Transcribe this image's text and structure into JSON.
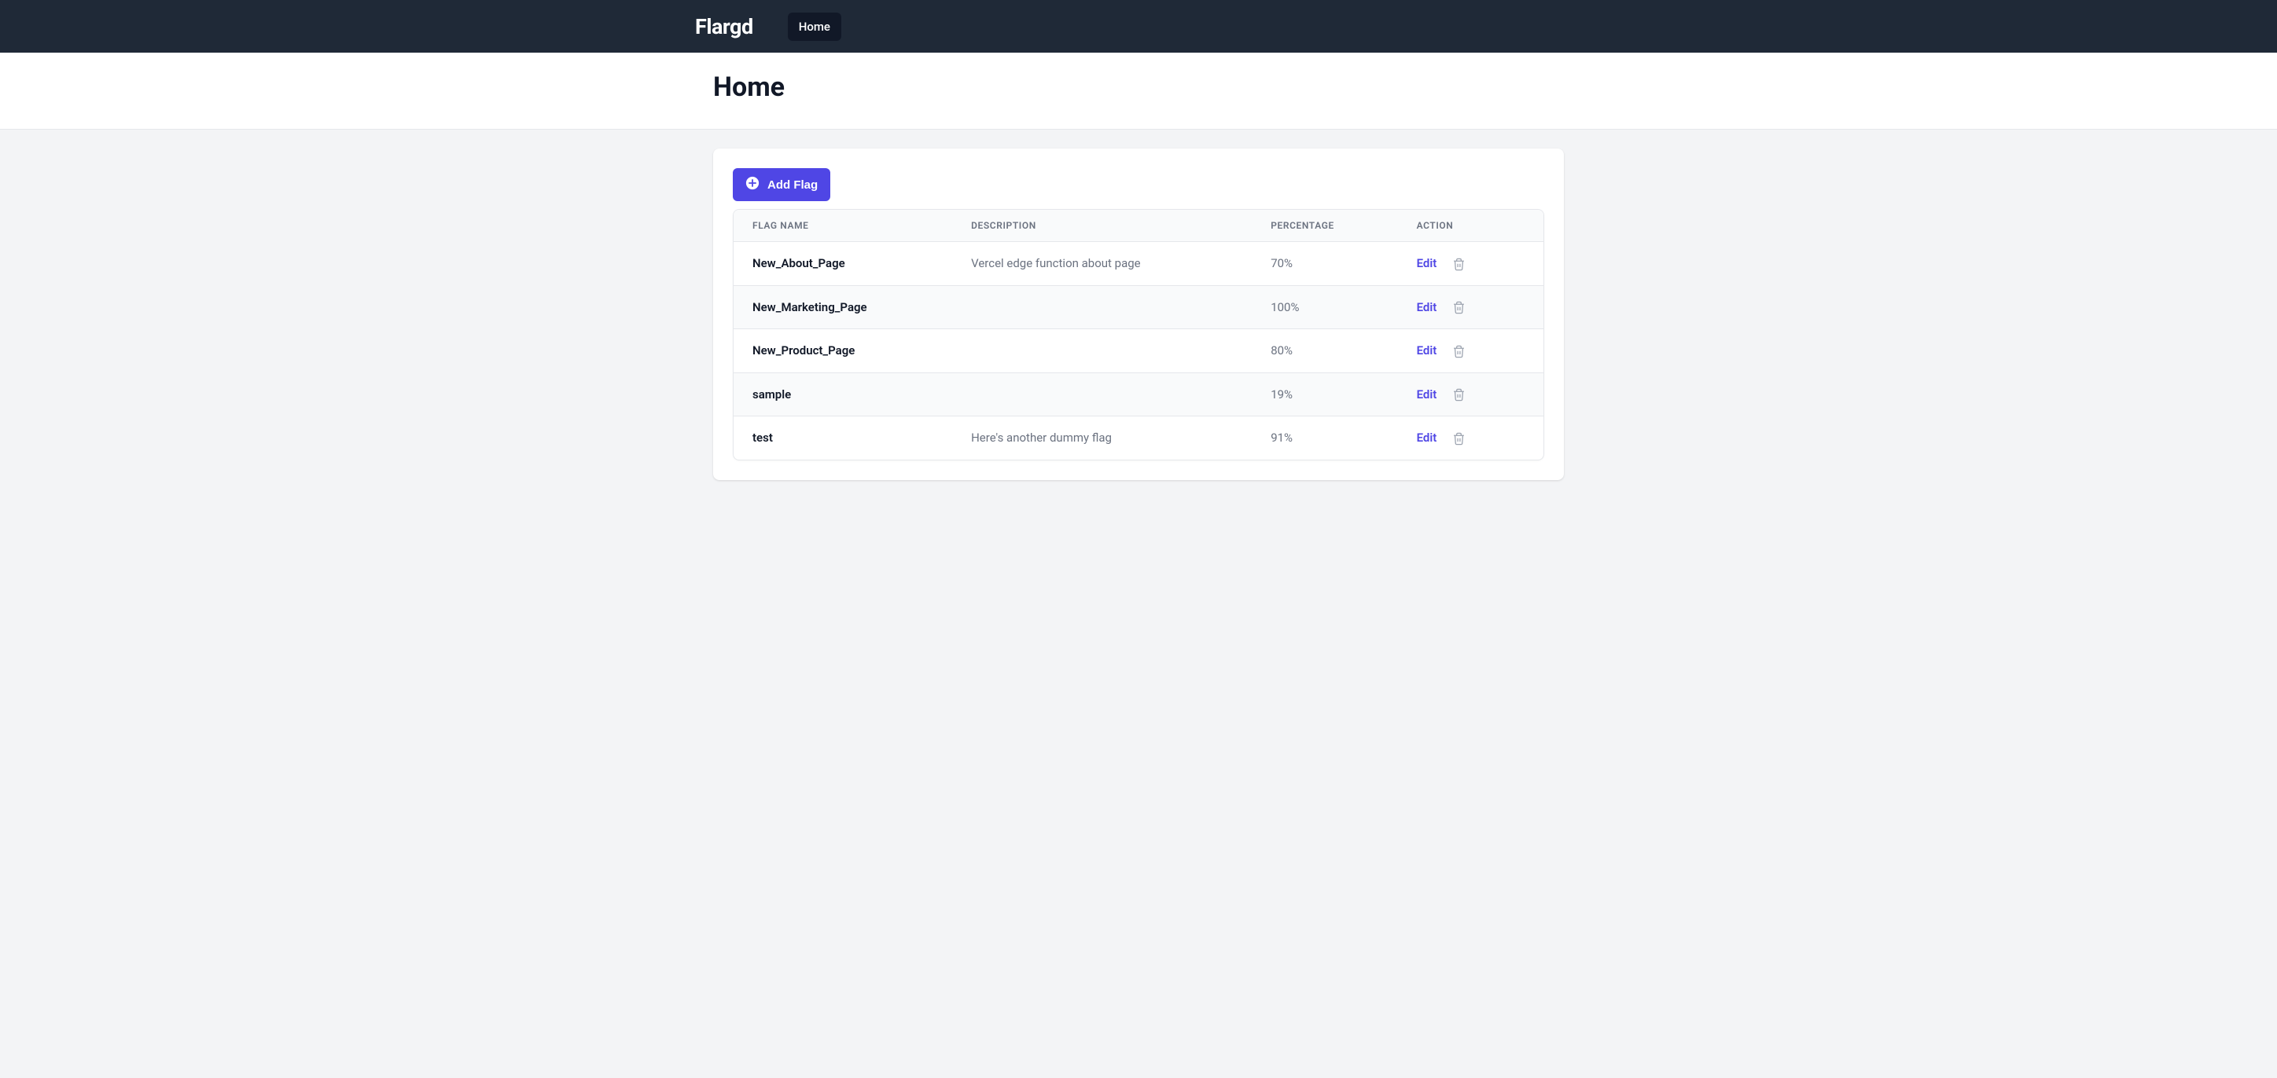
{
  "nav": {
    "brand": "Flargd",
    "home_label": "Home"
  },
  "header": {
    "title": "Home"
  },
  "actions": {
    "add_flag_label": "Add Flag",
    "edit_label": "Edit"
  },
  "table": {
    "columns": {
      "flag_name": "Flag Name",
      "description": "Description",
      "percentage": "Percentage",
      "action": "Action"
    },
    "rows": [
      {
        "flag_name": "New_About_Page",
        "description": "Vercel edge function about page",
        "percentage": "70%"
      },
      {
        "flag_name": "New_Marketing_Page",
        "description": "",
        "percentage": "100%"
      },
      {
        "flag_name": "New_Product_Page",
        "description": "",
        "percentage": "80%"
      },
      {
        "flag_name": "sample",
        "description": "",
        "percentage": "19%"
      },
      {
        "flag_name": "test",
        "description": "Here's another dummy flag",
        "percentage": "91%"
      }
    ]
  }
}
